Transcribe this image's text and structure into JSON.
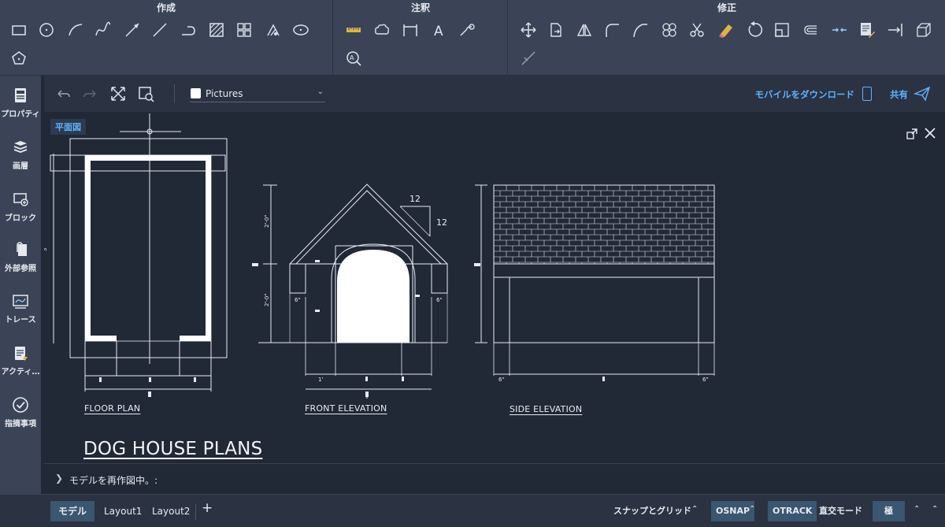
{
  "ribbon": {
    "groups": [
      {
        "title": "作成",
        "icons": [
          "rectangle-icon",
          "circle-icon",
          "arc-icon",
          "spline-icon",
          "line-arrow-icon",
          "line-icon",
          "polyline-icon",
          "hatch-icon",
          "grid-icon",
          "point-icon",
          "ellipse-icon",
          "polygon-icon"
        ]
      },
      {
        "title": "注釈",
        "icons": [
          "measure-icon",
          "cloud-icon",
          "dimension-icon",
          "text-icon",
          "leader-icon",
          "zoom-text-icon"
        ]
      },
      {
        "title": "修正",
        "icons": [
          "move-icon",
          "copy-icon",
          "mirror-icon",
          "fillet-icon",
          "offset-curve-icon",
          "array-icon",
          "trim-icon",
          "erase-icon",
          "rotate-icon",
          "scale-icon",
          "stretch-icon",
          "join-icon",
          "edit-icon",
          "extend-icon",
          "box-icon",
          "explode-icon"
        ]
      }
    ]
  },
  "sidebar": {
    "items": [
      {
        "label": "プロパティ",
        "icon": "properties-icon"
      },
      {
        "label": "画層",
        "icon": "layers-icon"
      },
      {
        "label": "ブロック",
        "icon": "block-icon"
      },
      {
        "label": "外部参照",
        "icon": "xref-icon"
      },
      {
        "label": "トレース",
        "icon": "trace-icon"
      },
      {
        "label": "アクティ…",
        "icon": "activity-icon"
      },
      {
        "label": "指摘事項",
        "icon": "markup-icon"
      }
    ]
  },
  "toolbar": {
    "layer_name": "Pictures",
    "mobile_label": "モバイルをダウンロード",
    "share_label": "共有"
  },
  "canvas": {
    "view_label": "平面図",
    "labels": {
      "floor_plan": "FLOOR PLAN",
      "front_elevation": "FRONT ELEVATION",
      "side_elevation": "SIDE ELEVATION",
      "title": "DOG HOUSE PLANS",
      "pitch_top": "12",
      "pitch_side": "12"
    }
  },
  "cmdline": {
    "text": "モデルを再作図中。:"
  },
  "statusbar": {
    "tabs": [
      "モデル",
      "Layout1",
      "Layout2"
    ],
    "snap_grid": "スナップとグリッド",
    "osnap": "OSNAP",
    "otrack": "OTRACK",
    "ortho": "直交モード",
    "polar": "極"
  },
  "colors": {
    "accent": "#5cb3ff",
    "panel": "#3b4456",
    "background": "#212836",
    "active_toggle": "#3a5670"
  }
}
